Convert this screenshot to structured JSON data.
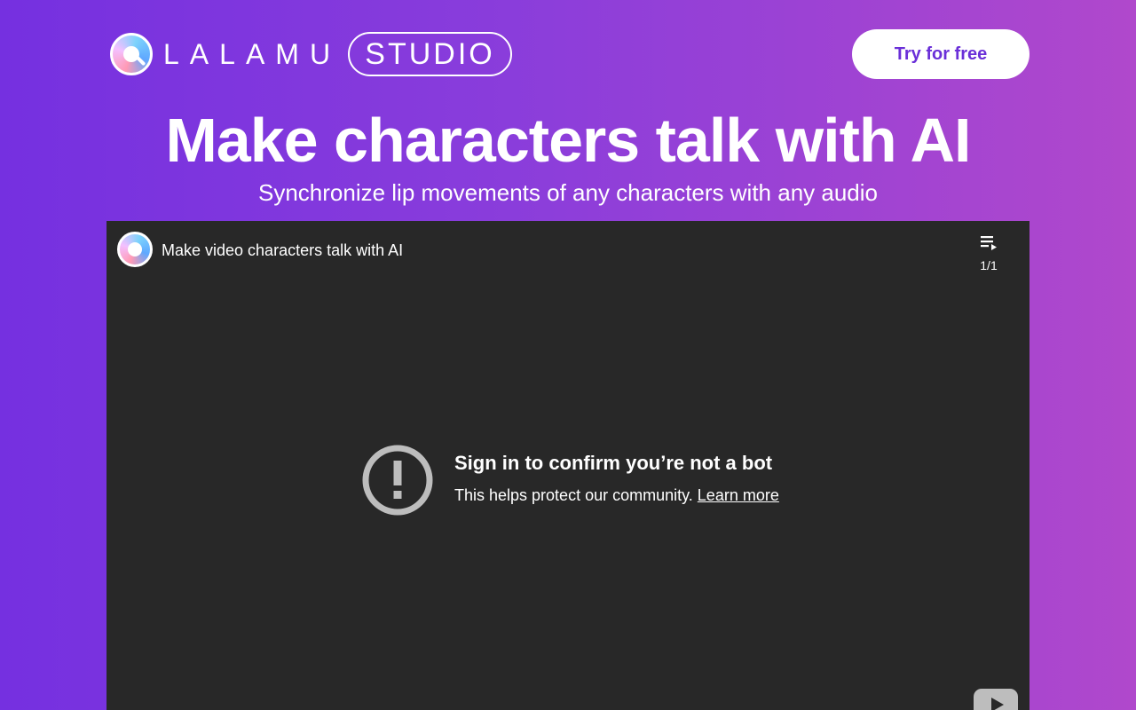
{
  "header": {
    "brand_name": "LALAMU",
    "badge": "STUDIO",
    "cta_label": "Try for free"
  },
  "hero": {
    "title": "Make characters talk with AI",
    "subtitle": "Synchronize lip movements of any characters with any audio"
  },
  "player": {
    "video_title": "Make video characters talk with AI",
    "playlist_count": "1/1",
    "error_title": "Sign in to confirm you’re not a bot",
    "error_body": "This helps protect our community.",
    "learn_more": "Learn more"
  },
  "icons": {
    "logo": "lalamu-logo-icon",
    "playlist": "playlist-icon",
    "warning": "exclamation-circle-icon",
    "youtube": "youtube-play-icon"
  },
  "colors": {
    "bg_start": "#7530e0",
    "bg_end": "#b048cc",
    "cta_text": "#6a2fd8",
    "player_bg": "#282828"
  }
}
